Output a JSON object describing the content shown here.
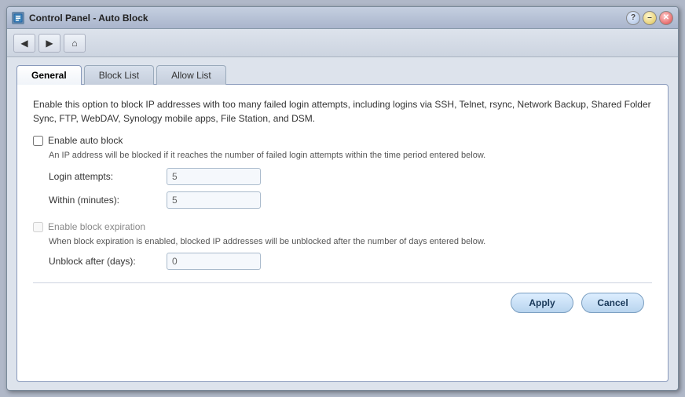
{
  "window": {
    "title": "Control Panel - Auto Block",
    "icon": "control-panel-icon"
  },
  "toolbar": {
    "back_label": "◀",
    "forward_label": "▶",
    "home_label": "⌂"
  },
  "tabs": [
    {
      "id": "general",
      "label": "General",
      "active": true
    },
    {
      "id": "block-list",
      "label": "Block List",
      "active": false
    },
    {
      "id": "allow-list",
      "label": "Allow List",
      "active": false
    }
  ],
  "panel": {
    "description": "Enable this option to block IP addresses with too many failed login attempts, including logins via SSH, Telnet, rsync, Network Backup, Shared Folder Sync, FTP, WebDAV, Synology mobile apps, File Station, and DSM.",
    "enable_auto_block": {
      "label": "Enable auto block",
      "checked": false
    },
    "auto_block_hint": "An IP address will be blocked if it reaches the number of failed login attempts within the time period entered below.",
    "login_attempts": {
      "label": "Login attempts:",
      "value": "5",
      "placeholder": "5"
    },
    "within_minutes": {
      "label": "Within (minutes):",
      "value": "5",
      "placeholder": "5"
    },
    "enable_block_expiration": {
      "label": "Enable block expiration",
      "checked": false,
      "disabled": true
    },
    "expiration_hint": "When block expiration is enabled, blocked IP addresses will be unblocked after the number of days entered below.",
    "unblock_after": {
      "label": "Unblock after (days):",
      "value": "0",
      "placeholder": "0"
    }
  },
  "footer": {
    "apply_label": "Apply",
    "cancel_label": "Cancel"
  },
  "title_buttons": {
    "help_label": "?",
    "minimize_label": "–",
    "close_label": "✕"
  }
}
